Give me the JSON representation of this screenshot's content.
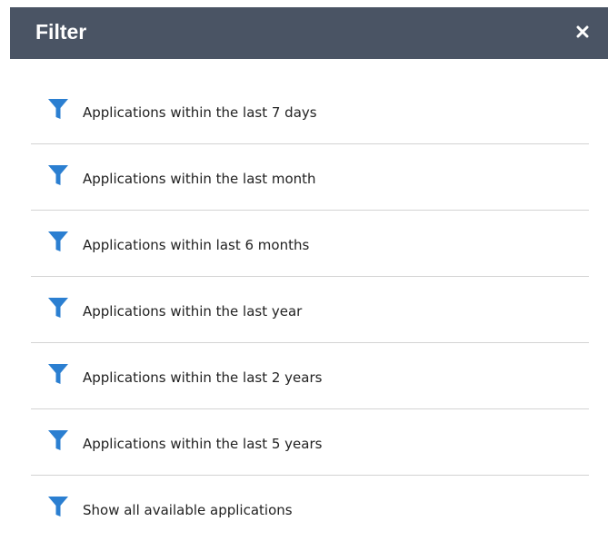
{
  "header": {
    "title": "Filter",
    "close_icon": "close-icon",
    "background_color": "#4a5464"
  },
  "filters": {
    "icon": "filter-funnel-icon",
    "icon_color": "#2b7fd1",
    "items": [
      {
        "label": "Applications within the last 7 days"
      },
      {
        "label": "Applications within the last month"
      },
      {
        "label": "Applications within last 6 months"
      },
      {
        "label": "Applications within the last year"
      },
      {
        "label": "Applications within the last 2 years"
      },
      {
        "label": "Applications within the last 5 years"
      },
      {
        "label": "Show all available applications"
      }
    ]
  }
}
